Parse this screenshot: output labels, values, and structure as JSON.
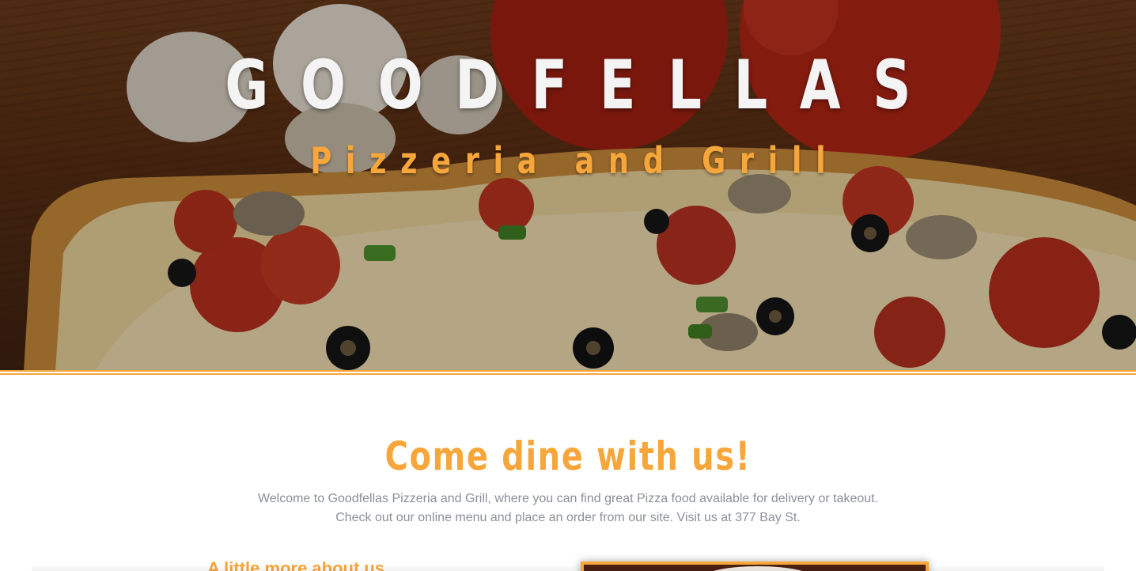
{
  "hero": {
    "title": "GOODFELLAS",
    "subtitle": "Pizzeria and Grill",
    "image_icon": "pizza-photo"
  },
  "intro": {
    "heading": "Come dine with us!",
    "line1": "Welcome to Goodfellas Pizzeria and Grill, where you can find great Pizza food available for delivery or takeout.",
    "line2": "Check out our online menu and place an order from our site. Visit us at 377 Bay St."
  },
  "about": {
    "heading": "A little more about us",
    "image_icon": "restaurant-photo"
  },
  "colors": {
    "accent": "#f7a63b",
    "body_text": "#8b8f97",
    "title_text": "#f4f4f4"
  }
}
